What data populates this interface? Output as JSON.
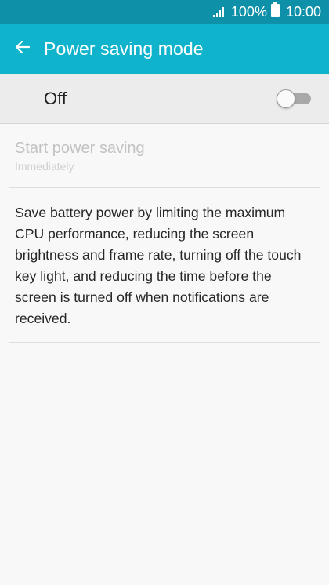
{
  "status_bar": {
    "battery_percent": "100%",
    "time": "10:00",
    "signal_icon": "signal-bars-icon",
    "battery_icon": "battery-full-icon"
  },
  "header": {
    "title": "Power saving mode",
    "back_icon": "arrow-left-icon"
  },
  "master_switch": {
    "label": "Off",
    "state": false
  },
  "setting": {
    "title": "Start power saving",
    "value": "Immediately",
    "enabled": false
  },
  "description": "Save battery power by limiting the maximum CPU performance, reducing the screen brightness and frame rate, turning off the touch key light, and reducing the time before the screen is turned off when notifications are received.",
  "colors": {
    "status_bar": "#0e91a8",
    "app_bar": "#0fb4cc",
    "background": "#f8f8f8"
  }
}
